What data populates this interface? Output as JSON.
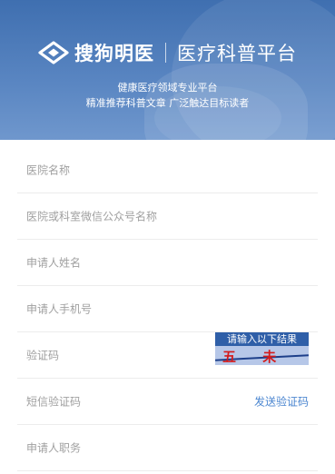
{
  "header": {
    "brand_name": "搜狗明医",
    "brand_sub": "医疗科普平台",
    "tagline_1": "健康医疗领域专业平台",
    "tagline_2": "精准推荐科普文章 广泛触达目标读者"
  },
  "form": {
    "hospital_name": "医院名称",
    "wechat_name": "医院或科室微信公众号名称",
    "applicant_name": "申请人姓名",
    "applicant_phone": "申请人手机号",
    "captcha_label": "验证码",
    "sms_label": "短信验证码",
    "send_code": "发送验证码",
    "applicant_title": "申请人职务"
  },
  "captcha": {
    "prompt": "请输入以下结果",
    "challenge": "五 未 壹"
  },
  "colors": {
    "hero": "#4a78b8",
    "link": "#4b86d0",
    "placeholder": "#a0a0a0"
  }
}
